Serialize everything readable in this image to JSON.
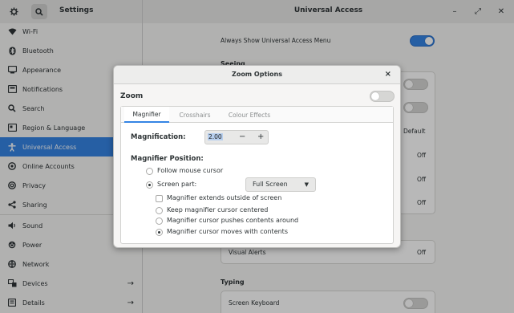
{
  "header": {
    "settings_title": "Settings",
    "panel_title": "Universal Access",
    "minimize": "–",
    "restore": "⤢",
    "close": "✕"
  },
  "sidebar": {
    "items": [
      {
        "label": "Wi-Fi",
        "icon": "wifi-icon",
        "glyph": "≋",
        "arrow": ""
      },
      {
        "label": "Bluetooth",
        "icon": "bluetooth-icon",
        "glyph": "ᛒ",
        "arrow": ""
      },
      {
        "label": "Appearance",
        "icon": "appearance-icon",
        "glyph": "▣",
        "arrow": ""
      },
      {
        "label": "Notifications",
        "icon": "notifications-icon",
        "glyph": "▤",
        "arrow": ""
      },
      {
        "label": "Search",
        "icon": "search-icon",
        "glyph": "⌕",
        "arrow": ""
      },
      {
        "label": "Region & Language",
        "icon": "region-icon",
        "glyph": "▦",
        "arrow": ""
      },
      {
        "label": "Universal Access",
        "icon": "universal-access-icon",
        "glyph": "☺",
        "arrow": ""
      },
      {
        "label": "Online Accounts",
        "icon": "online-accounts-icon",
        "glyph": "◉",
        "arrow": ""
      },
      {
        "label": "Privacy",
        "icon": "privacy-icon",
        "glyph": "◎",
        "arrow": ""
      },
      {
        "label": "Sharing",
        "icon": "sharing-icon",
        "glyph": "⋖",
        "arrow": ""
      },
      {
        "label": "Sound",
        "icon": "sound-icon",
        "glyph": "◀",
        "arrow": ""
      },
      {
        "label": "Power",
        "icon": "power-icon",
        "glyph": "⏻",
        "arrow": ""
      },
      {
        "label": "Network",
        "icon": "network-icon",
        "glyph": "⊛",
        "arrow": ""
      },
      {
        "label": "Devices",
        "icon": "devices-icon",
        "glyph": "⊞",
        "arrow": "→"
      },
      {
        "label": "Details",
        "icon": "details-icon",
        "glyph": "▥",
        "arrow": "→"
      }
    ]
  },
  "main": {
    "always_show_label": "Always Show Universal Access Menu",
    "seeing_title": "Seeing",
    "default_value": "Default",
    "off_values": [
      "Off",
      "Off",
      "Off"
    ],
    "visual_alerts_label": "Visual Alerts",
    "visual_alerts_value": "Off",
    "typing_title": "Typing",
    "screen_keyboard_label": "Screen Keyboard"
  },
  "dialog": {
    "title": "Zoom Options",
    "close": "×",
    "zoom_label": "Zoom",
    "tabs": [
      "Magnifier",
      "Crosshairs",
      "Colour Effects"
    ],
    "magnification_label": "Magnification:",
    "magnification_value": "2.00",
    "minus": "−",
    "plus": "+",
    "position_label": "Magnifier Position:",
    "follow_mouse": "Follow mouse cursor",
    "screen_part": "Screen part:",
    "screen_part_value": "Full Screen",
    "extends_outside": "Magnifier extends outside of screen",
    "keep_centered": "Keep magnifier cursor centered",
    "pushes_contents": "Magnifier cursor pushes contents around",
    "moves_with_contents": "Magnifier cursor moves with contents"
  },
  "colors": {
    "accent": "#3584e4",
    "sidebar_bg": "#f6f5f4",
    "header_bg": "#e8e8e7"
  }
}
